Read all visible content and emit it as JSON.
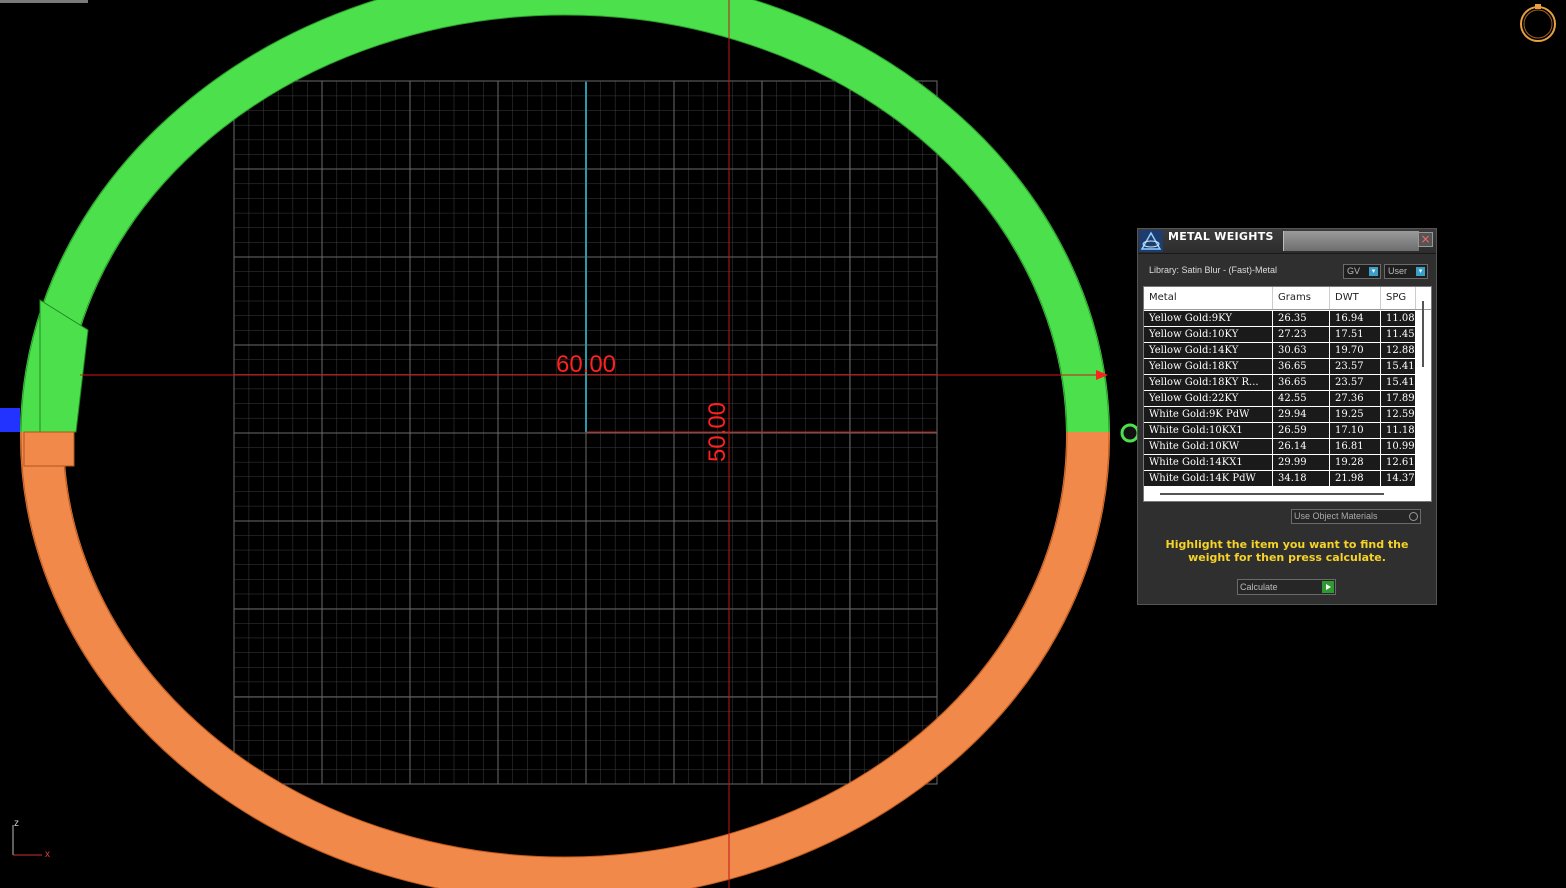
{
  "viewport": {
    "dim_horizontal": "60.00",
    "dim_vertical": "50.00",
    "axis_z": "z",
    "axis_x": "x"
  },
  "panel": {
    "title": "METAL WEIGHTS",
    "library": "Library: Satin Blur - (Fast)-Metal",
    "gv_label": "GV",
    "user_label": "User",
    "columns": [
      "Metal",
      "Grams",
      "DWT",
      "SPG"
    ],
    "rows": [
      [
        "Yellow Gold:9KY",
        "26.35",
        "16.94",
        "11.08"
      ],
      [
        "Yellow Gold:10KY",
        "27.23",
        "17.51",
        "11.45"
      ],
      [
        "Yellow Gold:14KY",
        "30.63",
        "19.70",
        "12.88"
      ],
      [
        "Yellow Gold:18KY",
        "36.65",
        "23.57",
        "15.41"
      ],
      [
        "Yellow Gold:18KY R...",
        "36.65",
        "23.57",
        "15.41"
      ],
      [
        "Yellow Gold:22KY",
        "42.55",
        "27.36",
        "17.89"
      ],
      [
        "White Gold:9K PdW",
        "29.94",
        "19.25",
        "12.59"
      ],
      [
        "White Gold:10KX1",
        "26.59",
        "17.10",
        "11.18"
      ],
      [
        "White Gold:10KW",
        "26.14",
        "16.81",
        "10.99"
      ],
      [
        "White Gold:14KX1",
        "29.99",
        "19.28",
        "12.61"
      ],
      [
        "White Gold:14K PdW",
        "34.18",
        "21.98",
        "14.37"
      ]
    ],
    "use_object_materials": "Use Object Materials",
    "hint": "Highlight the item you want to find the weight for then press calculate.",
    "calculate": "Calculate",
    "close": "×"
  },
  "colors": {
    "ring_green": "#4de04d",
    "ring_orange": "#f0894a",
    "dimension_red": "#ff2020",
    "grid": "#5a5a5a",
    "axis_cyan": "#2a9aa8",
    "hint_yellow": "#f5d328"
  }
}
